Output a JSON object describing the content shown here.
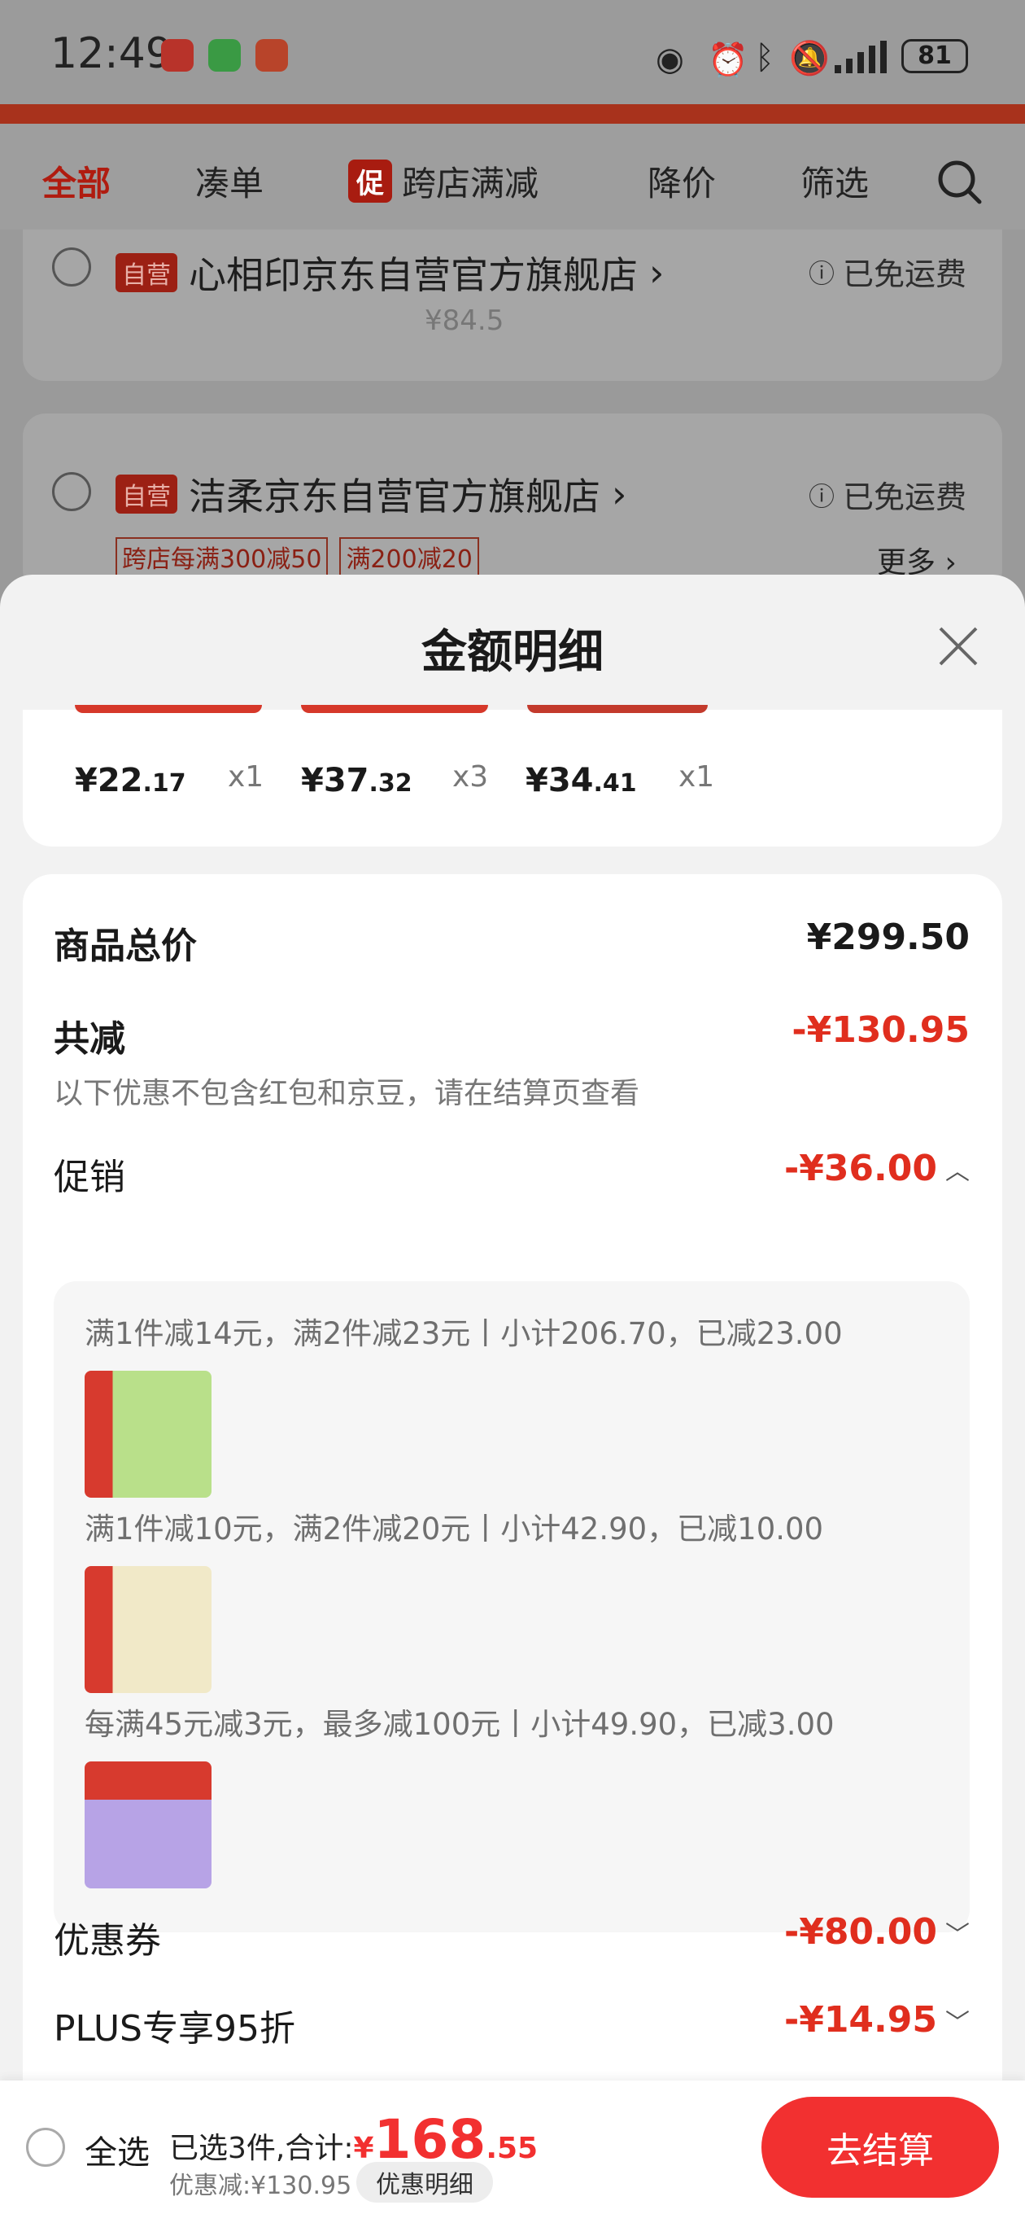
{
  "status": {
    "time": "12:49",
    "battery": "81"
  },
  "nav": {
    "tabs": [
      "全部",
      "凑单",
      "跨店满减",
      "降价",
      "筛选"
    ],
    "promo_badge": "促"
  },
  "stores": [
    {
      "self_label": "自营",
      "name": "心相印京东自营官方旗舰店",
      "shipping": "已免运费",
      "price": "¥84.5"
    },
    {
      "self_label": "自营",
      "name": "洁柔京东自营官方旗舰店",
      "shipping": "已免运费",
      "tags": [
        "跨店每满300减50",
        "满200减20"
      ],
      "more": "更多"
    }
  ],
  "sheet": {
    "title": "金额明细",
    "items": [
      {
        "yuan": "¥22",
        "cents": ".17",
        "qty": "x1"
      },
      {
        "yuan": "¥37",
        "cents": ".32",
        "qty": "x3"
      },
      {
        "yuan": "¥34",
        "cents": ".41",
        "qty": "x1"
      }
    ],
    "total_label": "商品总价",
    "total_value": "¥299.50",
    "discount_label": "共减",
    "discount_value": "-¥130.95",
    "discount_note": "以下优惠不包含红包和京豆，请在结算页查看",
    "promo_label": "促销",
    "promo_value": "-¥36.00",
    "promo_rules": [
      "满1件减14元，满2件减23元丨小计206.70，已减23.00",
      "满1件减10元，满2件减20元丨小计42.90，已减10.00",
      "每满45元减3元，最多减100元丨小计49.90，已减3.00"
    ],
    "coupon_label": "优惠券",
    "coupon_value": "-¥80.00",
    "plus_label": "PLUS专享95折",
    "plus_value": "-¥14.95"
  },
  "bottom": {
    "select_all": "全选",
    "summary": "已选3件,合计:",
    "currency": "¥",
    "total_int": "168",
    "total_dec": ".55",
    "saved": "优惠减:¥130.95",
    "detail_button": "优惠明细",
    "checkout": "去结算"
  },
  "colors": {
    "accent": "#e02e1e",
    "checkout": "#f23030"
  }
}
